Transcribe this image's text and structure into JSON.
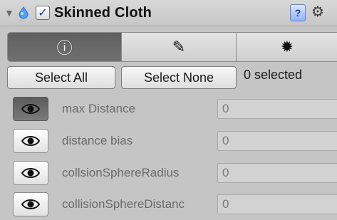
{
  "component": {
    "title": "Skinned Cloth",
    "enabled_mark": "✓"
  },
  "header": {
    "help_label": "?",
    "settings_icon": "⚙"
  },
  "tabs": [
    {
      "icon": "info-icon",
      "glyph": "ⓘ",
      "active": true
    },
    {
      "icon": "brush-icon",
      "glyph": "✎",
      "active": false
    },
    {
      "icon": "gear-icon",
      "glyph": "✹",
      "active": false
    }
  ],
  "actions": {
    "select_all_label": "Select All",
    "select_none_label": "Select None",
    "selected_status": "0 selected"
  },
  "properties": [
    {
      "label": "max Distance",
      "value": "0",
      "active": true
    },
    {
      "label": "distance bias",
      "value": "0",
      "active": false
    },
    {
      "label": "collsionSphereRadius",
      "value": "0",
      "active": false
    },
    {
      "label": "collisionSphereDistanc",
      "value": "0",
      "active": false
    }
  ]
}
